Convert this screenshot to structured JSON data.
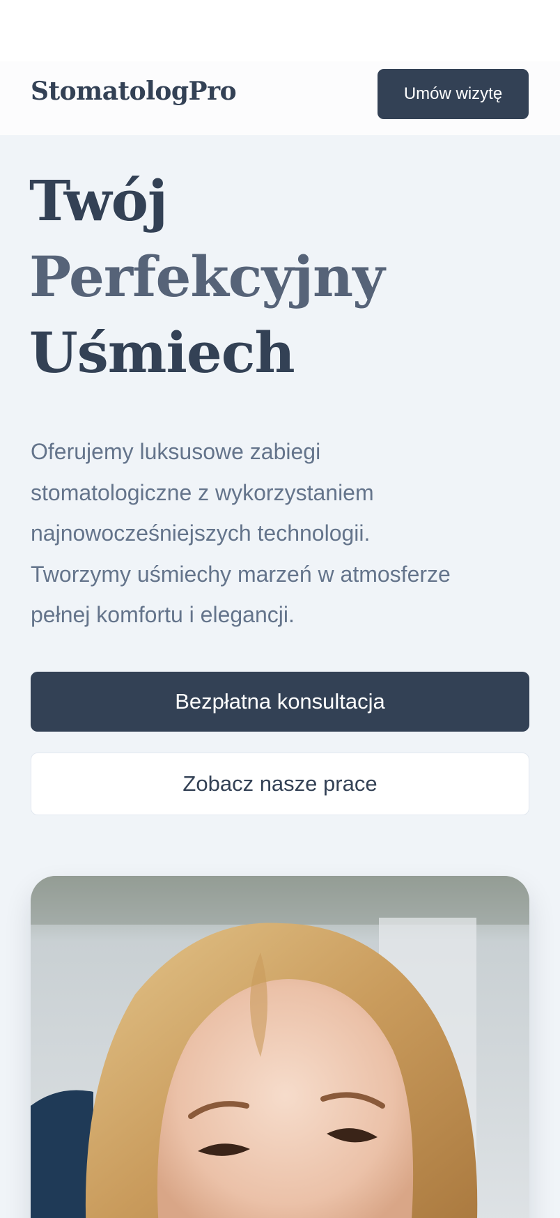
{
  "header": {
    "logo": "StomatologPro",
    "cta_label": "Umów wizytę"
  },
  "hero": {
    "headline": [
      "Twój",
      "Perfekcyjny",
      "Uśmiech"
    ],
    "lead": [
      "Oferujemy luksusowe zabiegi",
      "stomatologiczne z wykorzystaniem",
      "najnowocześniejszych technologii.",
      "Tworzymy uśmiechy marzeń w atmosferze",
      "pełnej komfortu i elegancji."
    ],
    "primary_button": "Bezpłatna konsultacja",
    "secondary_button": "Zobacz nasze prace"
  },
  "colors": {
    "brand_dark": "#334155",
    "headline_muted": "#566378",
    "hero_background": "#f0f4f8",
    "body_text": "#64748b"
  }
}
